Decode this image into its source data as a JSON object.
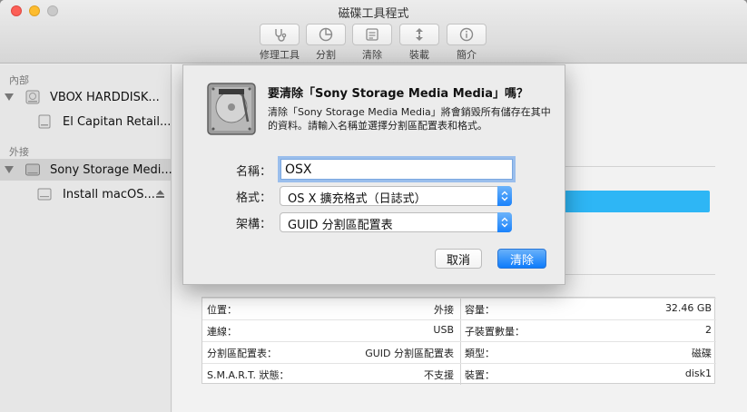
{
  "window": {
    "title": "磁碟工具程式"
  },
  "toolbar": [
    {
      "label": "修理工具",
      "icon": "stethoscope-icon"
    },
    {
      "label": "分割",
      "icon": "partition-pie-icon"
    },
    {
      "label": "清除",
      "icon": "erase-icon"
    },
    {
      "label": "裝載",
      "icon": "mount-icon"
    },
    {
      "label": "簡介",
      "icon": "info-icon"
    }
  ],
  "sidebar": {
    "internal_header": "內部",
    "external_header": "外接",
    "items": [
      {
        "label": "VBOX HARDDISK..."
      },
      {
        "label": "El Capitan Retail..."
      },
      {
        "label": "Sony Storage Medi..."
      },
      {
        "label": "Install macOS..."
      }
    ]
  },
  "dialog": {
    "title": "要清除「Sony Storage Media Media」嗎？",
    "message": "清除「Sony Storage Media Media」將會銷毀所有儲存在其中的資料。請輸入名稱並選擇分割區配置表和格式。",
    "name_label": "名稱：",
    "name_value": "OSX",
    "format_label": "格式：",
    "format_value": "OS X 擴充格式（日誌式）",
    "scheme_label": "架構：",
    "scheme_value": "GUID 分割區配置表",
    "cancel_label": "取消",
    "erase_label": "清除"
  },
  "info": {
    "rows": [
      {
        "left_label": "位置：",
        "left_value": "外接",
        "right_label": "容量：",
        "right_value": "32.46 GB"
      },
      {
        "left_label": "連線：",
        "left_value": "USB",
        "right_label": "子裝置數量：",
        "right_value": "2"
      },
      {
        "left_label": "分割區配置表：",
        "left_value": "GUID 分割區配置表",
        "right_label": "類型：",
        "right_value": "磁碟"
      },
      {
        "left_label": "S.M.A.R.T. 狀態：",
        "left_value": "不支援",
        "right_label": "裝置：",
        "right_value": "disk1"
      }
    ]
  },
  "colors": {
    "accent": "#1a82fb",
    "usage_bar": "#2eb6f5",
    "selection": "#d0d0d0"
  }
}
